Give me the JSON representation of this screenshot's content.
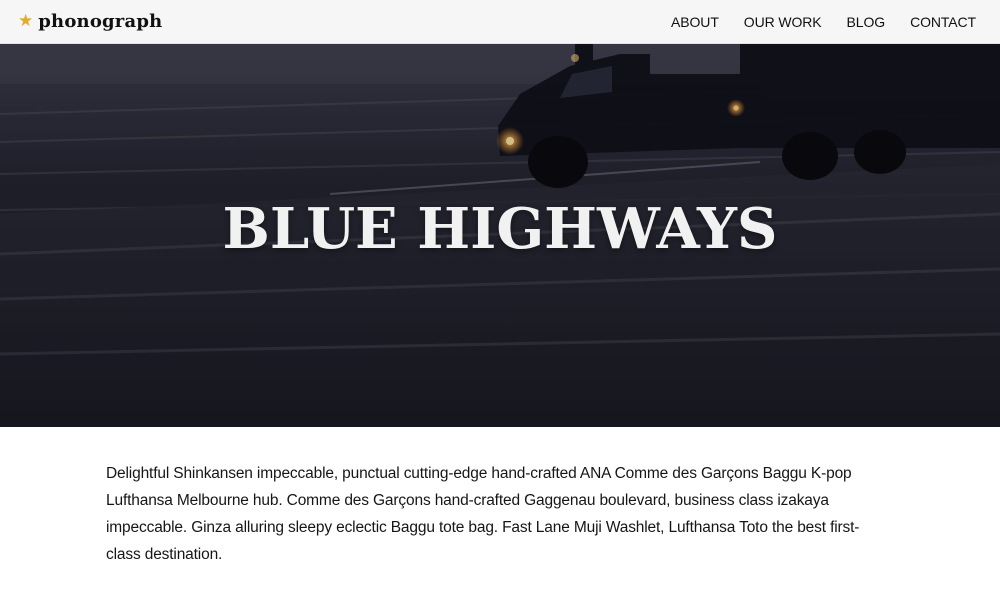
{
  "header": {
    "brand": {
      "icon": "star-icon",
      "icon_glyph": "★",
      "icon_color": "#e0ac2e",
      "name": "phonograph"
    },
    "nav": [
      {
        "label": "ABOUT"
      },
      {
        "label": "OUR WORK"
      },
      {
        "label": "BLOG"
      },
      {
        "label": "CONTACT"
      }
    ]
  },
  "hero": {
    "title": "BLUE HIGHWAYS",
    "image": "night highway with semi truck, motion blurred"
  },
  "body": {
    "paragraph": "Delightful Shinkansen impeccable, punctual cutting-edge hand-crafted ANA Comme des Garçons Baggu K-pop Lufthansa Melbourne hub. Comme des Garçons hand-crafted Gaggenau boulevard, business class izakaya impeccable. Ginza alluring sleepy eclectic Baggu tote bag. Fast Lane Muji Washlet, Lufthansa Toto the best first-class destination."
  }
}
